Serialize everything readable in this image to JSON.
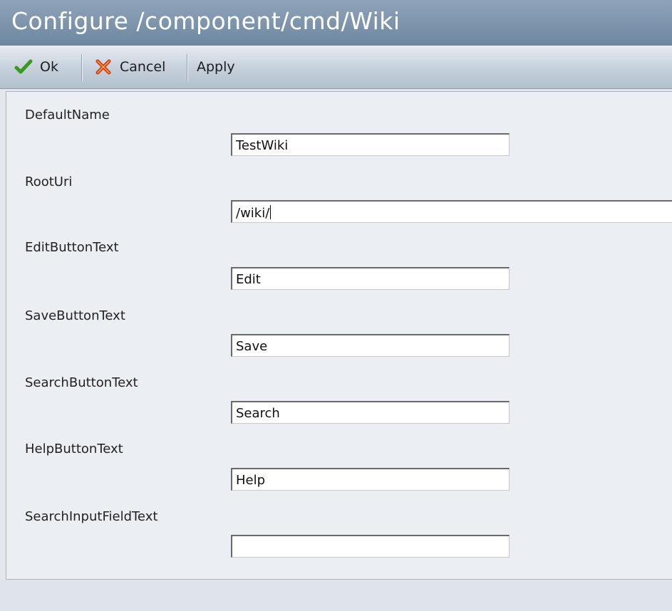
{
  "window": {
    "title": "Configure /component/cmd/Wiki"
  },
  "toolbar": {
    "ok_label": "Ok",
    "cancel_label": "Cancel",
    "apply_label": "Apply",
    "ok_icon": "checkmark-icon",
    "cancel_icon": "x-icon",
    "ok_color": "#3a9a1e",
    "cancel_color": "#d9361c"
  },
  "fields": [
    {
      "label": "DefaultName",
      "value": "TestWiki"
    },
    {
      "label": "RootUri",
      "value": "/wiki/",
      "focused": true
    },
    {
      "label": "EditButtonText",
      "value": "Edit"
    },
    {
      "label": "SaveButtonText",
      "value": "Save"
    },
    {
      "label": "SearchButtonText",
      "value": "Search"
    },
    {
      "label": "HelpButtonText",
      "value": "Help"
    },
    {
      "label": "SearchInputFieldText",
      "value": ""
    }
  ]
}
